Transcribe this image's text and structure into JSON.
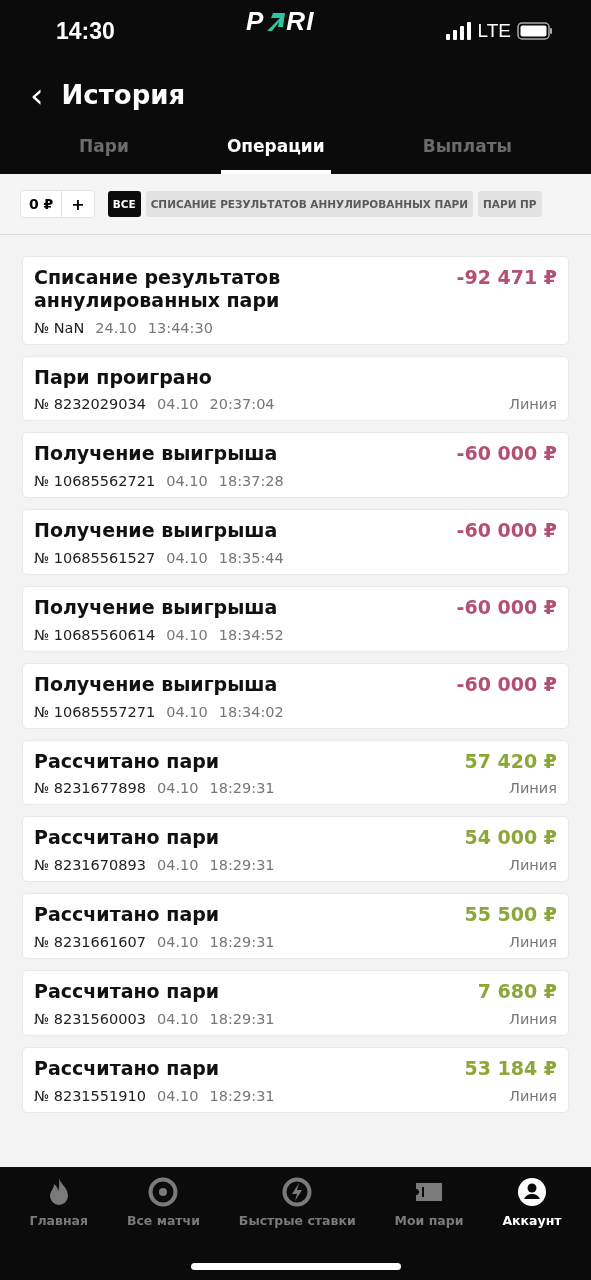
{
  "status_bar": {
    "time": "14:30",
    "network": "LTE"
  },
  "logo": {
    "before": "P",
    "after": "RI"
  },
  "header": {
    "back": "‹",
    "title": "История"
  },
  "tabs": [
    {
      "label": "Пари",
      "selected": false
    },
    {
      "label": "Операции",
      "selected": true
    },
    {
      "label": "Выплаты",
      "selected": false
    }
  ],
  "balance": {
    "value": "0 ₽",
    "add": "+"
  },
  "filters": [
    {
      "label": "ВСЕ",
      "selected": true
    },
    {
      "label": "СПИСАНИЕ РЕЗУЛЬТАТОВ АННУЛИРОВАННЫХ ПАРИ",
      "selected": false
    },
    {
      "label": "ПАРИ ПР",
      "selected": false
    }
  ],
  "operations": [
    {
      "title": "Списание результатов аннулированных пари",
      "amount": "-92 471 ₽",
      "kind": "debit",
      "number": "№ NaN",
      "date": "24.10",
      "time": "13:44:30"
    },
    {
      "title": "Пари проиграно",
      "number": "№ 8232029034",
      "date": "04.10",
      "time": "20:37:04",
      "channel": "Линия"
    },
    {
      "title": "Получение выигрыша",
      "amount": "-60 000 ₽",
      "kind": "debit",
      "number": "№ 10685562721",
      "date": "04.10",
      "time": "18:37:28"
    },
    {
      "title": "Получение выигрыша",
      "amount": "-60 000 ₽",
      "kind": "debit",
      "number": "№ 10685561527",
      "date": "04.10",
      "time": "18:35:44"
    },
    {
      "title": "Получение выигрыша",
      "amount": "-60 000 ₽",
      "kind": "debit",
      "number": "№ 10685560614",
      "date": "04.10",
      "time": "18:34:52"
    },
    {
      "title": "Получение выигрыша",
      "amount": "-60 000 ₽",
      "kind": "debit",
      "number": "№ 10685557271",
      "date": "04.10",
      "time": "18:34:02"
    },
    {
      "title": "Рассчитано пари",
      "amount": "57 420 ₽",
      "kind": "credit",
      "number": "№ 8231677898",
      "date": "04.10",
      "time": "18:29:31",
      "channel": "Линия"
    },
    {
      "title": "Рассчитано пари",
      "amount": "54 000 ₽",
      "kind": "credit",
      "number": "№ 8231670893",
      "date": "04.10",
      "time": "18:29:31",
      "channel": "Линия"
    },
    {
      "title": "Рассчитано пари",
      "amount": "55 500 ₽",
      "kind": "credit",
      "number": "№ 8231661607",
      "date": "04.10",
      "time": "18:29:31",
      "channel": "Линия"
    },
    {
      "title": "Рассчитано пари",
      "amount": "7 680 ₽",
      "kind": "credit",
      "number": "№ 8231560003",
      "date": "04.10",
      "time": "18:29:31",
      "channel": "Линия"
    },
    {
      "title": "Рассчитано пари",
      "amount": "53 184 ₽",
      "kind": "credit",
      "number": "№ 8231551910",
      "date": "04.10",
      "time": "18:29:31",
      "channel": "Линия"
    }
  ],
  "nav": [
    {
      "label": "Главная",
      "selected": false
    },
    {
      "label": "Все матчи",
      "selected": false
    },
    {
      "label": "Быстрые ставки",
      "selected": false
    },
    {
      "label": "Мои пари",
      "selected": false
    },
    {
      "label": "Аккаунт",
      "selected": true
    }
  ]
}
